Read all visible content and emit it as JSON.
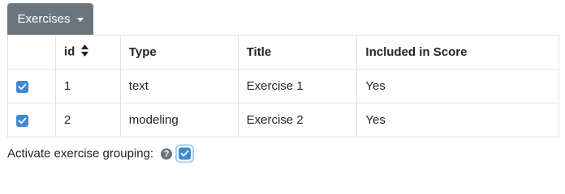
{
  "dropdown": {
    "label": "Exercises"
  },
  "table": {
    "headers": {
      "id": "id",
      "type": "Type",
      "title": "Title",
      "included": "Included in Score"
    },
    "rows": [
      {
        "checked": true,
        "id": "1",
        "type": "text",
        "title": "Exercise 1",
        "included": "Yes"
      },
      {
        "checked": true,
        "id": "2",
        "type": "modeling",
        "title": "Exercise 2",
        "included": "Yes"
      }
    ]
  },
  "grouping": {
    "label": "Activate exercise grouping:",
    "help_icon": "question-circle-icon",
    "checked": true
  },
  "colors": {
    "button_bg": "#6c757d",
    "checkbox_bg": "#3e8acc",
    "border": "#dee2e6"
  }
}
